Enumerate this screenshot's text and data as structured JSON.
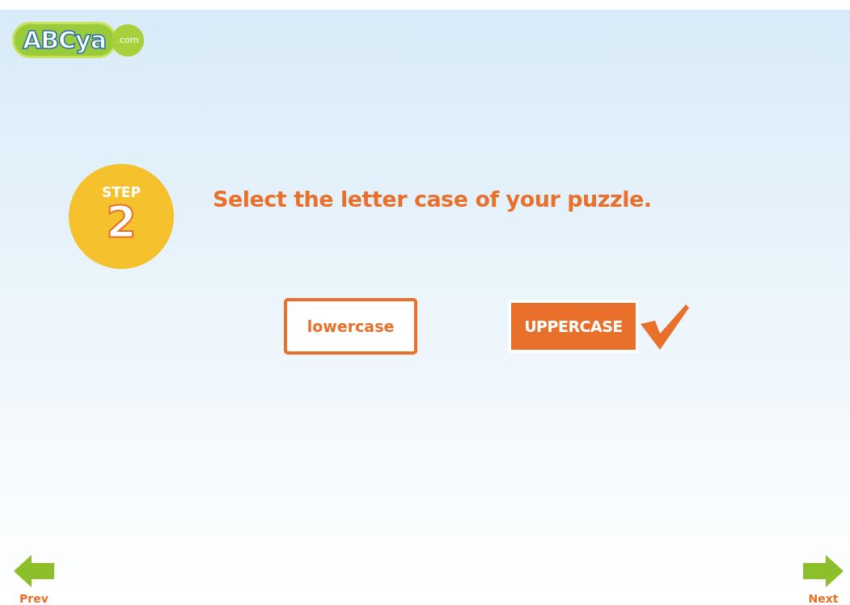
{
  "logo": {
    "name": "ABCya",
    "suffix": ".com"
  },
  "step": {
    "label": "STEP",
    "number": "2"
  },
  "instruction": "Select the letter case of your puzzle.",
  "options": [
    {
      "label": "lowercase",
      "selected": false
    },
    {
      "label": "UPPERCASE",
      "selected": true
    }
  ],
  "nav": [
    {
      "label": "Prev",
      "kind": "prev"
    },
    {
      "label": "Next",
      "kind": "next"
    }
  ]
}
